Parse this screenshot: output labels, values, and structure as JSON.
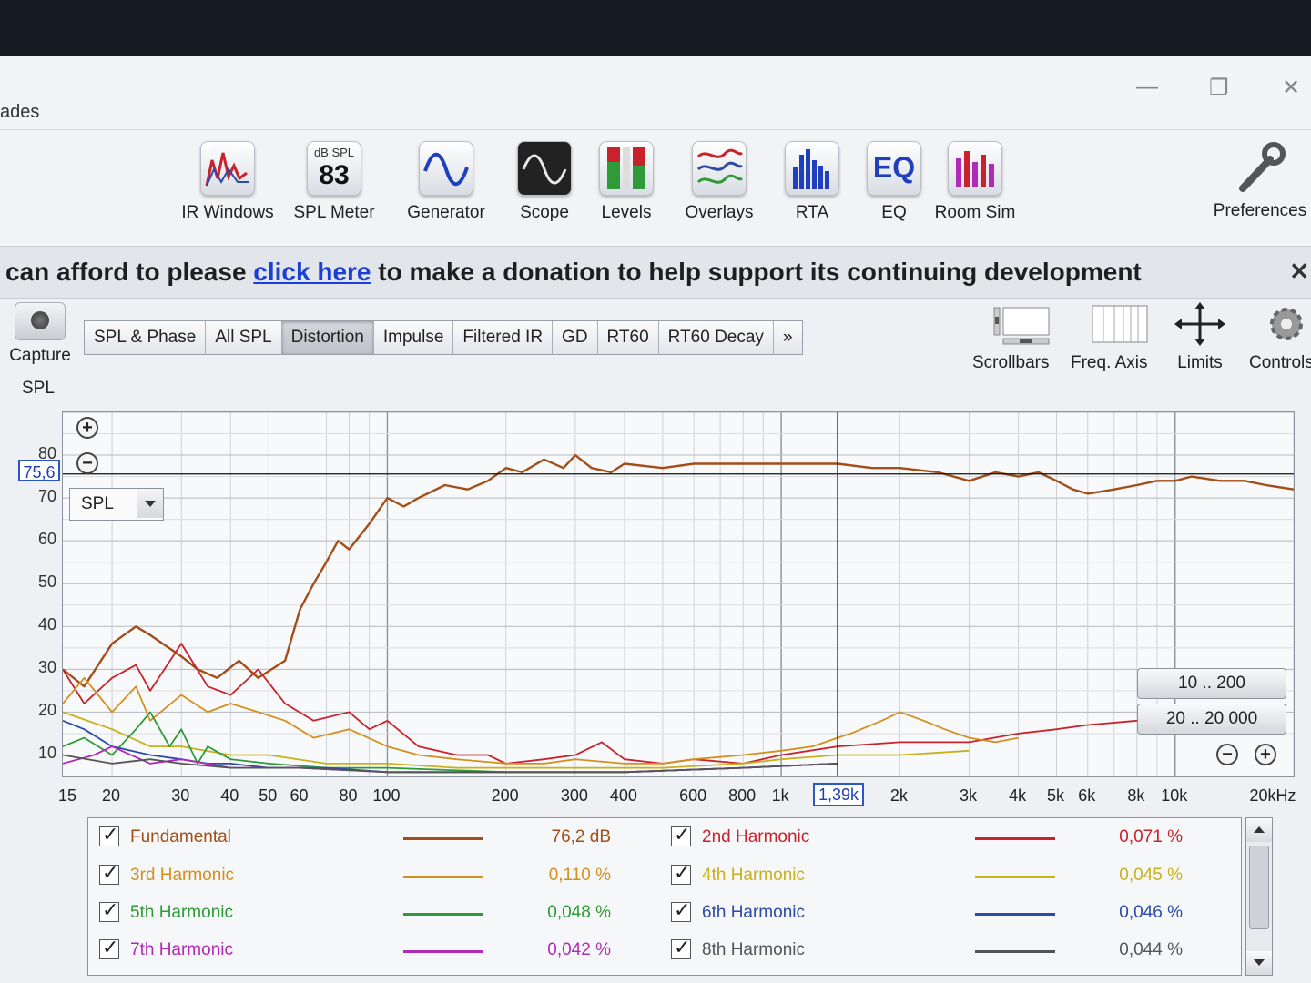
{
  "window": {
    "title": "ades"
  },
  "toolbar": [
    {
      "label": "IR Windows",
      "icon": "ir-windows-icon"
    },
    {
      "label": "SPL Meter",
      "icon": "spl-meter-icon",
      "badge_top": "dB SPL",
      "badge_value": "83"
    },
    {
      "label": "Generator",
      "icon": "generator-icon"
    },
    {
      "label": "Scope",
      "icon": "scope-icon"
    },
    {
      "label": "Levels",
      "icon": "levels-icon"
    },
    {
      "label": "Overlays",
      "icon": "overlays-icon"
    },
    {
      "label": "RTA",
      "icon": "rta-icon"
    },
    {
      "label": "EQ",
      "icon": "eq-icon",
      "badge_value": "EQ"
    },
    {
      "label": "Room Sim",
      "icon": "room-sim-icon"
    },
    {
      "label": "Preferences",
      "icon": "wrench-icon"
    }
  ],
  "banner": {
    "prefix": "can afford to please",
    "link": "click here",
    "suffix": "to make a donation to help support its continuing development"
  },
  "capture": {
    "label": "Capture"
  },
  "tabs": [
    "SPL & Phase",
    "All SPL",
    "Distortion",
    "Impulse",
    "Filtered IR",
    "GD",
    "RT60",
    "RT60 Decay",
    "»"
  ],
  "active_tab": "Distortion",
  "right_tools": [
    {
      "label": "Scrollbars",
      "icon": "scrollbars-icon"
    },
    {
      "label": "Freq. Axis",
      "icon": "freq-axis-icon"
    },
    {
      "label": "Limits",
      "icon": "limits-icon"
    },
    {
      "label": "Controls",
      "icon": "gear-icon"
    }
  ],
  "graph": {
    "ylabel": "SPL",
    "selector": "SPL",
    "cursor_y": "75,6",
    "cursor_x": "1,39k",
    "range_buttons": [
      "10 .. 200",
      "20 .. 20 000"
    ]
  },
  "legend": [
    {
      "name": "Fundamental",
      "value": "76,2 dB",
      "color": "#a24e18"
    },
    {
      "name": "2nd Harmonic",
      "value": "0,071 %",
      "color": "#c8232c"
    },
    {
      "name": "3rd Harmonic",
      "value": "0,110 %",
      "color": "#d4901e"
    },
    {
      "name": "4th Harmonic",
      "value": "0,045 %",
      "color": "#c8b01e"
    },
    {
      "name": "5th Harmonic",
      "value": "0,048 %",
      "color": "#2e9a38"
    },
    {
      "name": "6th Harmonic",
      "value": "0,046 %",
      "color": "#2d4aa8"
    },
    {
      "name": "7th Harmonic",
      "value": "0,042 %",
      "color": "#b02ab8"
    },
    {
      "name": "8th Harmonic",
      "value": "0,044 %",
      "color": "#555555"
    }
  ],
  "chart_data": {
    "type": "line",
    "title": "",
    "xlabel": "",
    "ylabel": "SPL",
    "x_scale": "log",
    "xlim": [
      15,
      20000
    ],
    "ylim": [
      5,
      90
    ],
    "xticks": [
      "15",
      "20",
      "30",
      "40",
      "50",
      "60",
      "80",
      "100",
      "200",
      "300",
      "400",
      "600",
      "800",
      "1k",
      "2k",
      "3k",
      "4k",
      "5k",
      "6k",
      "8k",
      "10k",
      "20kHz"
    ],
    "yticks": [
      "10",
      "20",
      "30",
      "40",
      "50",
      "60",
      "70",
      "80"
    ],
    "cursor": {
      "x": 1390,
      "y": 75.6
    },
    "series": [
      {
        "name": "Fundamental",
        "color": "#a24e18",
        "x": [
          15,
          17,
          20,
          23,
          25,
          30,
          33,
          37,
          42,
          47,
          55,
          60,
          65,
          70,
          75,
          80,
          90,
          100,
          110,
          120,
          140,
          160,
          180,
          200,
          220,
          250,
          280,
          300,
          330,
          370,
          400,
          500,
          600,
          800,
          1000,
          1390,
          1700,
          2000,
          2500,
          3000,
          3500,
          4000,
          4500,
          5000,
          5500,
          6000,
          7000,
          8000,
          9000,
          10000,
          11000,
          13000,
          15000,
          17000,
          20000
        ],
        "y": [
          30,
          26,
          36,
          40,
          38,
          33,
          30,
          28,
          32,
          28,
          32,
          44,
          50,
          55,
          60,
          58,
          64,
          70,
          68,
          70,
          73,
          72,
          74,
          77,
          76,
          79,
          77,
          80,
          77,
          76,
          78,
          77,
          78,
          78,
          78,
          78,
          77,
          77,
          76,
          74,
          76,
          75,
          76,
          74,
          72,
          71,
          72,
          73,
          74,
          74,
          75,
          74,
          74,
          73,
          72
        ]
      },
      {
        "name": "2nd Harmonic",
        "color": "#c8232c",
        "x": [
          15,
          17,
          20,
          23,
          25,
          30,
          35,
          40,
          47,
          55,
          65,
          80,
          90,
          100,
          120,
          150,
          180,
          200,
          250,
          300,
          350,
          400,
          500,
          600,
          800,
          1000,
          1390,
          2000,
          3000,
          4000,
          5000,
          6000,
          8000,
          10000
        ],
        "y": [
          30,
          22,
          28,
          31,
          25,
          36,
          26,
          24,
          30,
          22,
          18,
          20,
          16,
          18,
          12,
          10,
          10,
          8,
          9,
          10,
          13,
          9,
          8,
          9,
          8,
          10,
          12,
          13,
          13,
          15,
          16,
          17,
          18,
          19
        ]
      },
      {
        "name": "3rd Harmonic",
        "color": "#d4901e",
        "x": [
          15,
          17,
          20,
          23,
          25,
          30,
          35,
          40,
          47,
          55,
          65,
          80,
          100,
          120,
          150,
          200,
          250,
          300,
          400,
          500,
          600,
          800,
          1000,
          1200,
          1390,
          1500,
          1800,
          2000,
          2300,
          2600,
          3000,
          3500,
          4000
        ],
        "y": [
          22,
          28,
          20,
          26,
          18,
          24,
          20,
          22,
          20,
          18,
          14,
          16,
          12,
          10,
          9,
          8,
          8,
          9,
          8,
          8,
          9,
          10,
          11,
          12,
          14,
          15,
          18,
          20,
          18,
          16,
          14,
          13,
          14
        ]
      },
      {
        "name": "4th Harmonic",
        "color": "#c8b01e",
        "x": [
          15,
          20,
          25,
          30,
          40,
          50,
          70,
          100,
          150,
          200,
          300,
          500,
          800,
          1000,
          1390,
          2000,
          3000
        ],
        "y": [
          20,
          16,
          12,
          12,
          10,
          10,
          8,
          8,
          7,
          7,
          7,
          7,
          8,
          9,
          10,
          10,
          11
        ]
      },
      {
        "name": "5th Harmonic",
        "color": "#2e9a38",
        "x": [
          15,
          17,
          20,
          23,
          25,
          28,
          30,
          33,
          35,
          40,
          50,
          70,
          100,
          200,
          400,
          800,
          1390
        ],
        "y": [
          12,
          14,
          10,
          16,
          20,
          12,
          16,
          8,
          12,
          9,
          8,
          7,
          7,
          6,
          6,
          7,
          8
        ]
      },
      {
        "name": "6th Harmonic",
        "color": "#2d4aa8",
        "x": [
          15,
          17,
          20,
          25,
          30,
          35,
          40,
          50,
          70,
          100,
          200,
          400,
          800,
          1390
        ],
        "y": [
          18,
          16,
          12,
          10,
          9,
          8,
          8,
          7,
          7,
          6,
          6,
          6,
          7,
          8
        ]
      },
      {
        "name": "7th Harmonic",
        "color": "#b02ab8",
        "x": [
          15,
          18,
          20,
          25,
          30,
          40,
          60,
          100,
          200,
          400,
          800,
          1390
        ],
        "y": [
          8,
          10,
          12,
          8,
          9,
          7,
          7,
          6,
          6,
          6,
          7,
          8
        ]
      },
      {
        "name": "8th Harmonic",
        "color": "#555555",
        "x": [
          15,
          20,
          25,
          30,
          40,
          60,
          100,
          200,
          400,
          800,
          1390
        ],
        "y": [
          10,
          8,
          9,
          8,
          7,
          7,
          6,
          6,
          6,
          7,
          8
        ]
      }
    ]
  }
}
